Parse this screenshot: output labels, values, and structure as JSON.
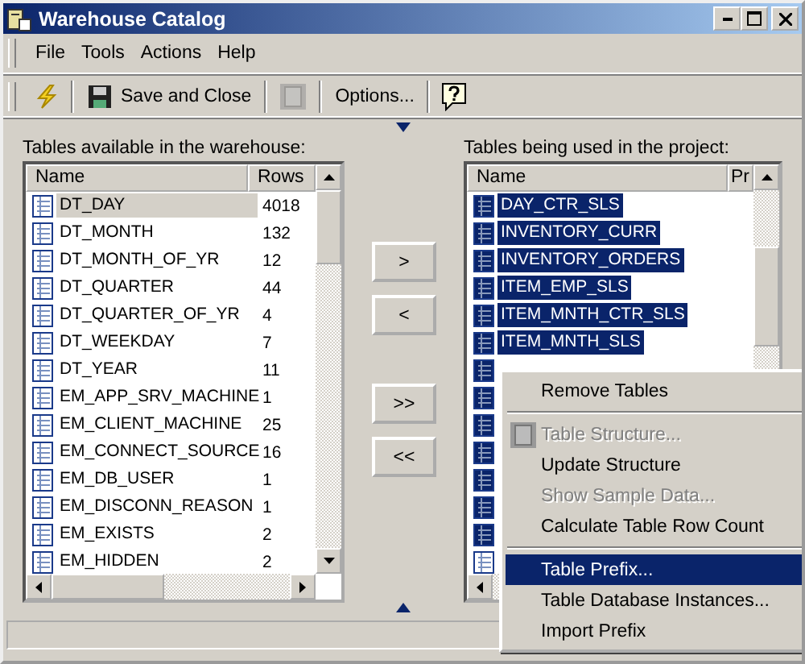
{
  "window": {
    "title": "Warehouse Catalog"
  },
  "menu_bar": [
    "File",
    "Tools",
    "Actions",
    "Help"
  ],
  "toolbar": [
    {
      "kind": "icon",
      "disabled": false
    },
    {
      "kind": "button",
      "label": "Save and Close"
    },
    {
      "kind": "icon",
      "disabled": true
    },
    {
      "kind": "button",
      "label": "Options..."
    },
    {
      "kind": "icon",
      "disabled": false
    }
  ],
  "available": {
    "label": "Tables available in the warehouse:",
    "columns": [
      "Name",
      "Rows"
    ],
    "rows": [
      {
        "name": "DT_DAY",
        "rows": "4018",
        "selected": true
      },
      {
        "name": "DT_MONTH",
        "rows": "132",
        "selected": false
      },
      {
        "name": "DT_MONTH_OF_YR",
        "rows": "12",
        "selected": false
      },
      {
        "name": "DT_QUARTER",
        "rows": "44",
        "selected": false
      },
      {
        "name": "DT_QUARTER_OF_YR",
        "rows": "4",
        "selected": false
      },
      {
        "name": "DT_WEEKDAY",
        "rows": "7",
        "selected": false
      },
      {
        "name": "DT_YEAR",
        "rows": "11",
        "selected": false
      },
      {
        "name": "EM_APP_SRV_MACHINE",
        "rows": "1",
        "selected": false
      },
      {
        "name": "EM_CLIENT_MACHINE",
        "rows": "25",
        "selected": false
      },
      {
        "name": "EM_CONNECT_SOURCE",
        "rows": "16",
        "selected": false
      },
      {
        "name": "EM_DB_USER",
        "rows": "1",
        "selected": false
      },
      {
        "name": "EM_DISCONN_REASON",
        "rows": "1",
        "selected": false
      },
      {
        "name": "EM_EXISTS",
        "rows": "2",
        "selected": false
      },
      {
        "name": "EM_HIDDEN",
        "rows": "2",
        "selected": false
      }
    ]
  },
  "move_buttons": [
    ">",
    "<",
    ">>",
    "<<"
  ],
  "used": {
    "label": "Tables being used in the project:",
    "columns": [
      "Name",
      "Pr"
    ],
    "rows": [
      {
        "name": "DAY_CTR_SLS",
        "selected": true
      },
      {
        "name": "INVENTORY_CURR",
        "selected": true
      },
      {
        "name": "INVENTORY_ORDERS",
        "selected": true
      },
      {
        "name": "ITEM_EMP_SLS",
        "selected": true
      },
      {
        "name": "ITEM_MNTH_CTR_SLS",
        "selected": true
      },
      {
        "name": "ITEM_MNTH_SLS",
        "selected": true
      },
      {
        "selected": true
      },
      {
        "selected": true
      },
      {
        "selected": true
      },
      {
        "selected": true
      },
      {
        "selected": true
      },
      {
        "selected": true
      },
      {
        "selected": true
      },
      {
        "selected": false
      }
    ]
  },
  "context_menu": [
    {
      "label": "Remove Tables",
      "disabled": false,
      "selected": false
    },
    {
      "kind": "separator"
    },
    {
      "label": "Table Structure...",
      "disabled": true,
      "selected": false,
      "icon": true
    },
    {
      "label": "Update Structure",
      "disabled": false,
      "selected": false
    },
    {
      "label": "Show Sample Data...",
      "disabled": true,
      "selected": false
    },
    {
      "label": "Calculate Table Row Count",
      "disabled": false,
      "selected": false
    },
    {
      "kind": "separator"
    },
    {
      "label": "Table Prefix...",
      "disabled": false,
      "selected": true
    },
    {
      "label": "Table Database Instances...",
      "disabled": false,
      "selected": false
    },
    {
      "label": "Import Prefix",
      "disabled": false,
      "selected": false
    }
  ]
}
